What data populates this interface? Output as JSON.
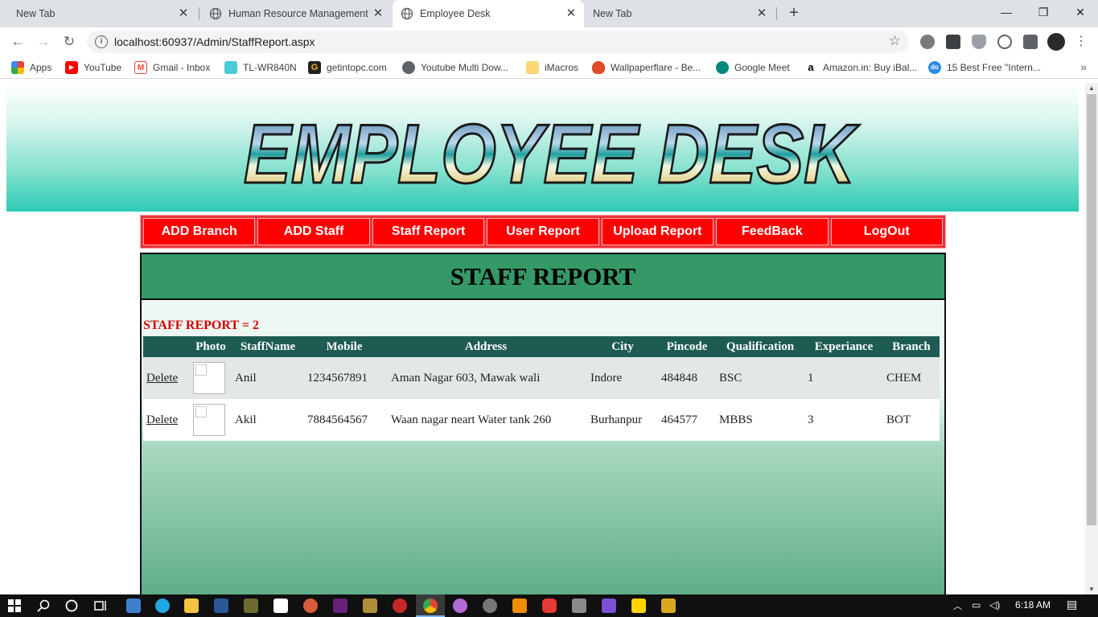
{
  "browser": {
    "tabs": [
      {
        "title": "New Tab",
        "active": false
      },
      {
        "title": "Human Resource Management S",
        "active": false
      },
      {
        "title": "Employee Desk",
        "active": true
      },
      {
        "title": "New Tab",
        "active": false
      }
    ],
    "url": "localhost:60937/Admin/StaffReport.aspx",
    "bookmarks": [
      {
        "label": "Apps",
        "icon": "apps-grid-icon"
      },
      {
        "label": "YouTube",
        "icon": "youtube-icon"
      },
      {
        "label": "Gmail - Inbox",
        "icon": "gmail-icon"
      },
      {
        "label": "TL-WR840N",
        "icon": "tplink-icon"
      },
      {
        "label": "getintopc.com",
        "icon": "getintopc-icon"
      },
      {
        "label": "Youtube Multi Dow...",
        "icon": "globe-icon"
      },
      {
        "label": "iMacros",
        "icon": "folder-icon"
      },
      {
        "label": "Wallpaperflare - Be...",
        "icon": "flame-icon"
      },
      {
        "label": "Google Meet",
        "icon": "google-meet-icon"
      },
      {
        "label": "Amazon.in: Buy iBal...",
        "icon": "amazon-icon"
      },
      {
        "label": "15 Best Free \"Intern...",
        "icon": "do-icon"
      }
    ]
  },
  "site": {
    "logo_text": "EMPLOYEE DESK",
    "menu": [
      "ADD Branch",
      "ADD Staff",
      "Staff Report",
      "User Report",
      "Upload Report",
      "FeedBack",
      "LogOut"
    ],
    "page_title": "STAFF REPORT",
    "count_label": "STAFF REPORT = 2",
    "table": {
      "columns": [
        "",
        "Photo",
        "StaffName",
        "Mobile",
        "Address",
        "City",
        "Pincode",
        "Qualification",
        "Experiance",
        "Branch"
      ],
      "rows": [
        {
          "action": "Delete",
          "name": "Anil",
          "mobile": "1234567891",
          "address": "Aman Nagar 603, Mawak wali",
          "city": "Indore",
          "pincode": "484848",
          "qualification": "BSC",
          "experience": "1",
          "branch": "CHEM"
        },
        {
          "action": "Delete",
          "name": "Akil",
          "mobile": "7884564567",
          "address": "Waan nagar neart Water tank 260",
          "city": "Burhanpur",
          "pincode": "464577",
          "qualification": "MBBS",
          "experience": "3",
          "branch": "BOT"
        }
      ]
    }
  },
  "taskbar": {
    "time": "6:18 AM"
  },
  "colors": {
    "menu_red": "#ff0000",
    "title_green": "#349966",
    "header_row": "#1e5c53",
    "count_red": "#d40000"
  }
}
